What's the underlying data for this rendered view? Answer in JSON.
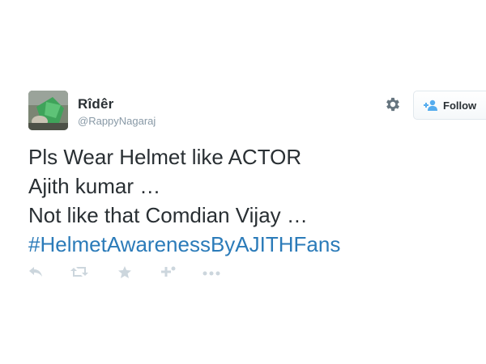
{
  "user": {
    "display_name": "Rîdêr",
    "handle": "@RappyNagaraj"
  },
  "header": {
    "settings_icon": "gear-icon",
    "follow_label": "Follow"
  },
  "tweet": {
    "lines": [
      "Pls Wear Helmet like ACTOR",
      "Ajith kumar …",
      "Not like that Comdian Vijay …"
    ],
    "hashtag": "#HelmetAwarenessByAJITHFans"
  },
  "actions": [
    {
      "name": "reply-icon"
    },
    {
      "name": "retweet-icon"
    },
    {
      "name": "favorite-icon"
    },
    {
      "name": "pin-icon"
    },
    {
      "name": "more-icon"
    }
  ],
  "colors": {
    "text": "#292f33",
    "muted": "#8899a6",
    "link": "#2b7bb9",
    "button_border": "#e1e8ed"
  }
}
